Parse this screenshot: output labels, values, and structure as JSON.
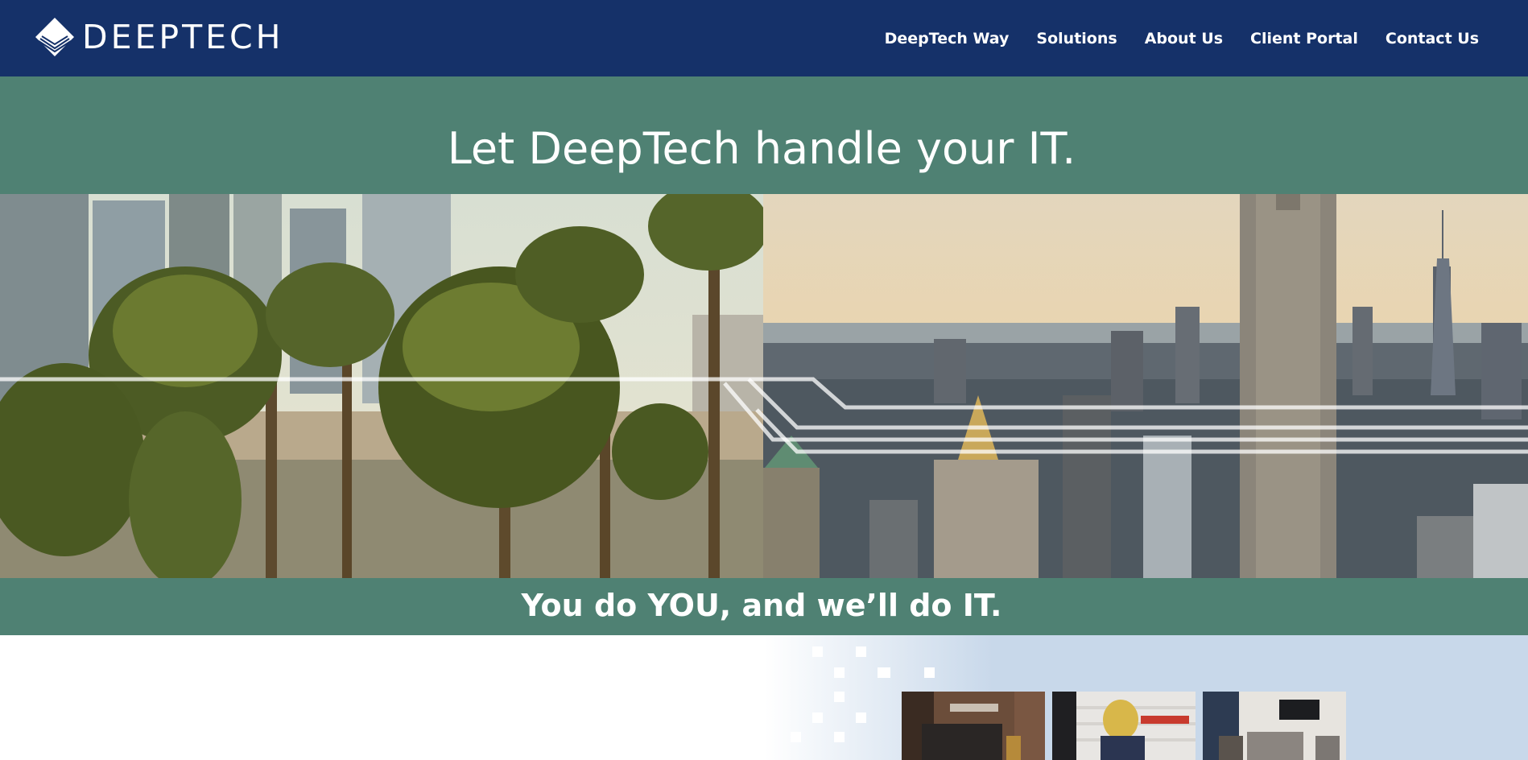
{
  "header": {
    "logo_text": "DEEPTECH",
    "nav": [
      {
        "label": "DeepTech Way"
      },
      {
        "label": "Solutions"
      },
      {
        "label": "About Us"
      },
      {
        "label": "Client Portal"
      },
      {
        "label": "Contact Us"
      }
    ]
  },
  "hero": {
    "headline": "Let DeepTech handle your IT.",
    "tagline": "You do YOU, and we’ll do IT."
  },
  "colors": {
    "header_bg": "#153169",
    "band_bg": "#4f8173",
    "panel_bg": "#c8d8ea",
    "text": "#ffffff"
  },
  "icons": {
    "logo": "deeptech-diamond-logo-icon"
  }
}
